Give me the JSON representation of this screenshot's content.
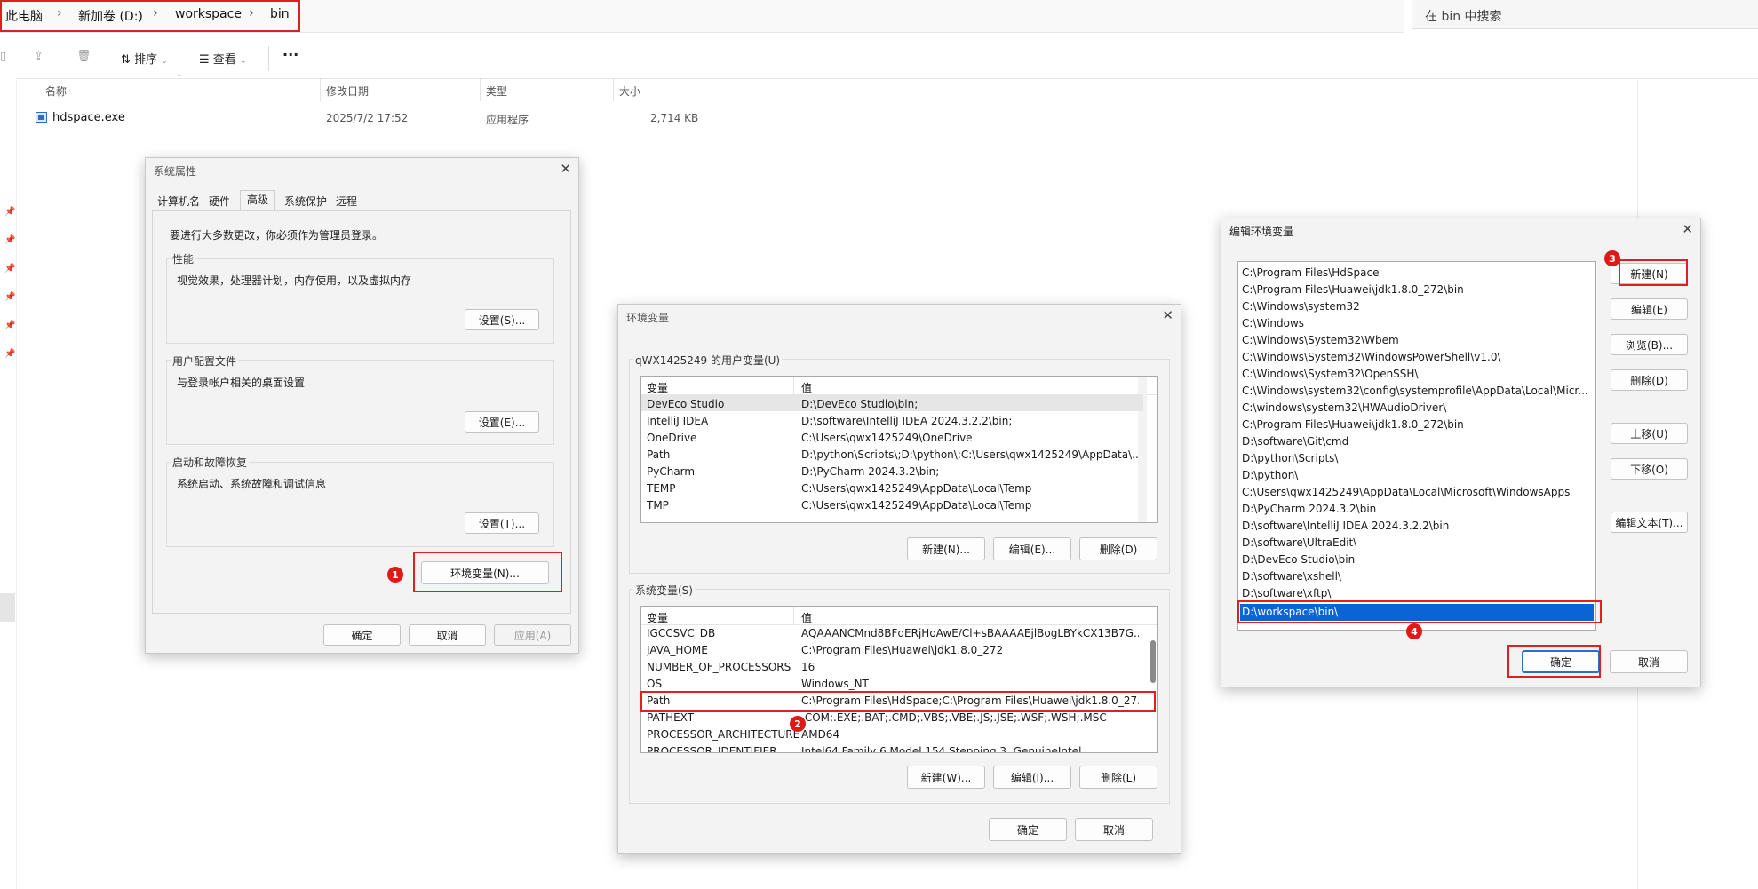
{
  "explorer": {
    "breadcrumbs": [
      "此电脑",
      "新加卷 (D:)",
      "workspace",
      "bin"
    ],
    "search_placeholder": "在 bin 中搜索",
    "toolbar": {
      "sort": "排序",
      "view": "查看",
      "more": "···"
    },
    "columns": [
      "名称",
      "修改日期",
      "类型",
      "大小"
    ],
    "files": [
      {
        "name": "hdspace.exe",
        "modified": "2025/7/2 17:52",
        "type": "应用程序",
        "size": "2,714 KB"
      }
    ]
  },
  "sys_props": {
    "title": "系统属性",
    "tabs": [
      "计算机名",
      "硬件",
      "高级",
      "系统保护",
      "远程"
    ],
    "admin_note": "要进行大多数更改，你必须作为管理员登录。",
    "perf": {
      "title": "性能",
      "desc": "视觉效果，处理器计划，内存使用，以及虚拟内存",
      "button": "设置(S)..."
    },
    "profile": {
      "title": "用户配置文件",
      "desc": "与登录帐户相关的桌面设置",
      "button": "设置(E)..."
    },
    "startup": {
      "title": "启动和故障恢复",
      "desc": "系统启动、系统故障和调试信息",
      "button": "设置(T)..."
    },
    "env_button": "环境变量(N)...",
    "ok": "确定",
    "cancel": "取消",
    "apply": "应用(A)"
  },
  "env_vars": {
    "title": "环境变量",
    "user_group": "qWX1425249 的用户变量(U)",
    "col_var": "变量",
    "col_val": "值",
    "user_vars": [
      {
        "name": "DevEco Studio",
        "value": "D:\\DevEco Studio\\bin;"
      },
      {
        "name": "IntelliJ IDEA",
        "value": "D:\\software\\IntelliJ IDEA 2024.3.2.2\\bin;"
      },
      {
        "name": "OneDrive",
        "value": "C:\\Users\\qwx1425249\\OneDrive"
      },
      {
        "name": "Path",
        "value": "D:\\python\\Scripts\\;D:\\python\\;C:\\Users\\qwx1425249\\AppData\\..."
      },
      {
        "name": "PyCharm",
        "value": "D:\\PyCharm 2024.3.2\\bin;"
      },
      {
        "name": "TEMP",
        "value": "C:\\Users\\qwx1425249\\AppData\\Local\\Temp"
      },
      {
        "name": "TMP",
        "value": "C:\\Users\\qwx1425249\\AppData\\Local\\Temp"
      }
    ],
    "user_buttons": [
      "新建(N)...",
      "编辑(E)...",
      "删除(D)"
    ],
    "sys_group": "系统变量(S)",
    "sys_vars": [
      {
        "name": "IGCCSVC_DB",
        "value": "AQAAANCMnd8BFdERjHoAwE/Cl+sBAAAAEjlBogLBYkCX13B7G..."
      },
      {
        "name": "JAVA_HOME",
        "value": "C:\\Program Files\\Huawei\\jdk1.8.0_272"
      },
      {
        "name": "NUMBER_OF_PROCESSORS",
        "value": "16"
      },
      {
        "name": "OS",
        "value": "Windows_NT"
      },
      {
        "name": "Path",
        "value": "C:\\Program Files\\HdSpace;C:\\Program Files\\Huawei\\jdk1.8.0_27..."
      },
      {
        "name": "PATHEXT",
        "value": ".COM;.EXE;.BAT;.CMD;.VBS;.VBE;.JS;.JSE;.WSF;.WSH;.MSC"
      },
      {
        "name": "PROCESSOR_ARCHITECTURE",
        "value": "AMD64"
      },
      {
        "name": "PROCESSOR_IDENTIFIER",
        "value": "Intel64 Family 6 Model 154 Stepping 3, GenuineIntel"
      }
    ],
    "sys_buttons": [
      "新建(W)...",
      "编辑(I)...",
      "删除(L)"
    ],
    "ok": "确定",
    "cancel": "取消"
  },
  "edit_env": {
    "title": "编辑环境变量",
    "paths": [
      "C:\\Program Files\\HdSpace",
      "C:\\Program Files\\Huawei\\jdk1.8.0_272\\bin",
      "C:\\Windows\\system32",
      "C:\\Windows",
      "C:\\Windows\\System32\\Wbem",
      "C:\\Windows\\System32\\WindowsPowerShell\\v1.0\\",
      "C:\\Windows\\System32\\OpenSSH\\",
      "C:\\Windows\\system32\\config\\systemprofile\\AppData\\Local\\Micr...",
      "C:\\windows\\system32\\HWAudioDriver\\",
      "C:\\Program Files\\Huawei\\jdk1.8.0_272\\bin",
      "D:\\software\\Git\\cmd",
      "D:\\python\\Scripts\\",
      "D:\\python\\",
      "C:\\Users\\qwx1425249\\AppData\\Local\\Microsoft\\WindowsApps",
      "D:\\PyCharm 2024.3.2\\bin",
      "D:\\software\\IntelliJ IDEA 2024.3.2.2\\bin",
      "D:\\software\\UltraEdit\\",
      "D:\\DevEco Studio\\bin",
      "D:\\software\\xshell\\",
      "D:\\software\\xftp\\",
      "D:\\workspace\\bin\\"
    ],
    "buttons": [
      "新建(N)",
      "编辑(E)",
      "浏览(B)...",
      "删除(D)",
      "上移(U)",
      "下移(O)",
      "编辑文本(T)..."
    ],
    "ok": "确定",
    "cancel": "取消"
  },
  "markers": [
    "1",
    "2",
    "3",
    "4"
  ]
}
